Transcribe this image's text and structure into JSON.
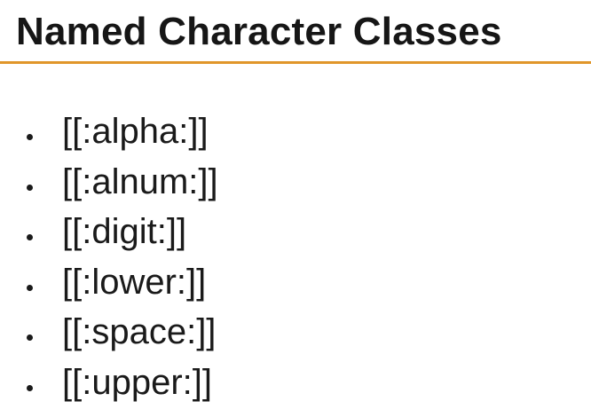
{
  "slide": {
    "title": "Named Character Classes",
    "accent_color": "#e0962a",
    "bullets": [
      "[[:alpha:]]",
      "[[:alnum:]]",
      "[[:digit:]]",
      "[[:lower:]]",
      "[[:space:]]",
      "[[:upper:]]"
    ]
  }
}
